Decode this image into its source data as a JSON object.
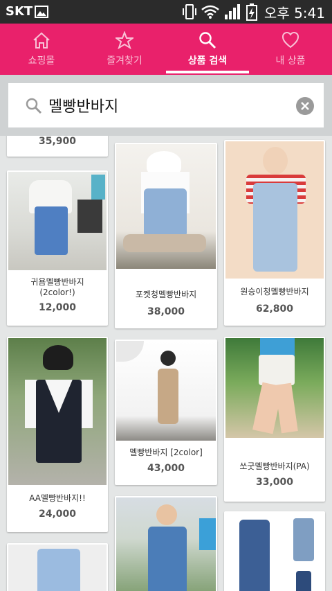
{
  "status_bar": {
    "carrier": "SKT",
    "time": "오후 5:41"
  },
  "tabs": [
    {
      "label": "쇼핑몰",
      "icon": "home-icon",
      "active": false
    },
    {
      "label": "즐겨찾기",
      "icon": "star-icon",
      "active": false
    },
    {
      "label": "상품 검색",
      "icon": "search-icon",
      "active": true
    },
    {
      "label": "내 상품",
      "icon": "heart-icon",
      "active": false
    }
  ],
  "search": {
    "value": "멜빵반바지"
  },
  "products": [
    {
      "price": "35,900"
    },
    {
      "name": "귀욤멜빵반바지\n(2color!)",
      "price": "12,000"
    },
    {
      "name": "포켓청멜빵반바지",
      "price": "38,000"
    },
    {
      "name": "원승이청멜빵반바지",
      "price": "62,800"
    },
    {
      "name": "AA멜빵반바지!!",
      "price": "24,000"
    },
    {
      "name": "멜빵반바지 [2color]",
      "price": "43,000"
    },
    {
      "name": "쏘굿멜빵반바지(PA)",
      "price": "33,000"
    }
  ],
  "colors": {
    "accent": "#e9216b",
    "status_bar": "#2b2b2b"
  }
}
